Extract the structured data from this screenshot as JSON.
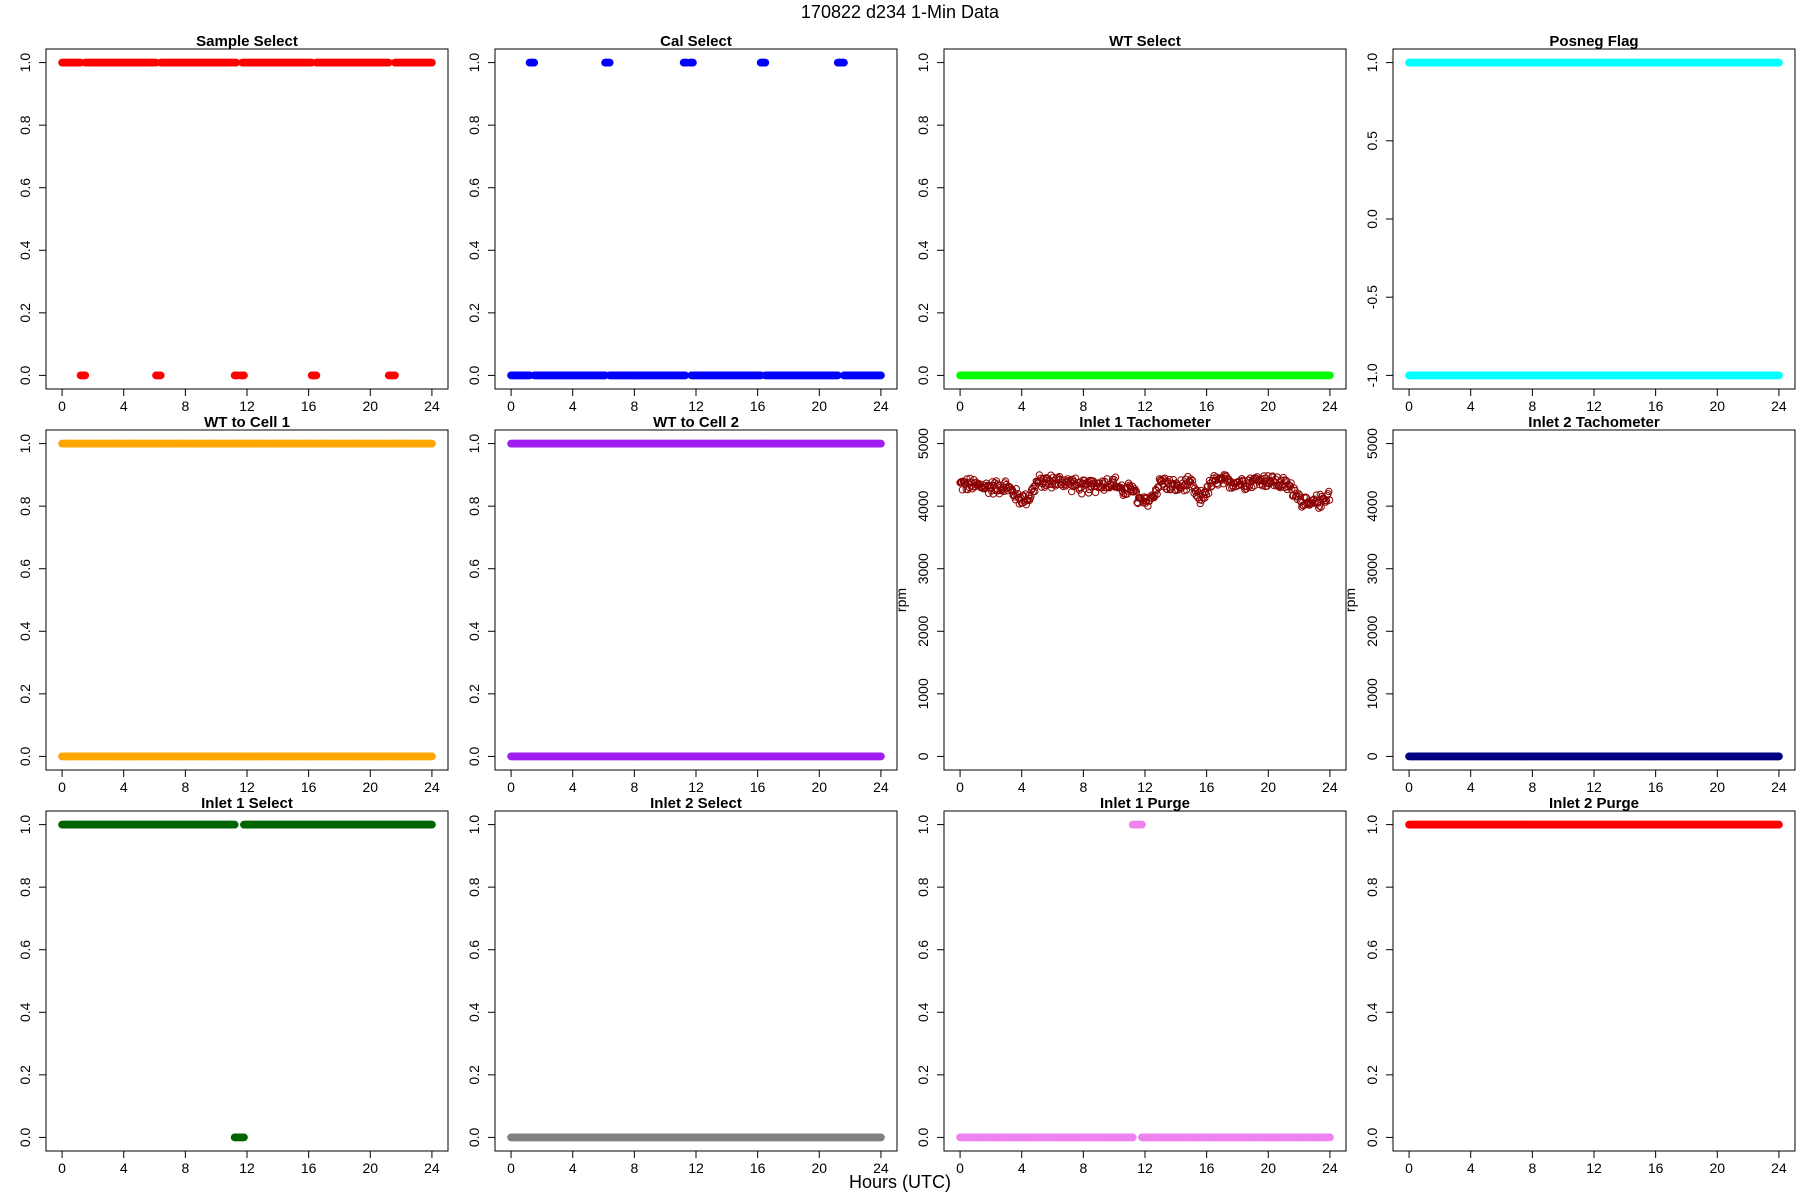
{
  "page_title": "170822   d234   1-Min Data",
  "x_axis_title": "Hours (UTC)",
  "chart_data": [
    {
      "type": "scatter",
      "title": "Sample Select",
      "color": "#ff0000",
      "marker": "filled",
      "xlim": [
        0,
        24
      ],
      "ylim": [
        0,
        1
      ],
      "xticks": [
        0,
        4,
        8,
        12,
        16,
        20,
        24
      ],
      "yticks": [
        0,
        0.2,
        0.4,
        0.6,
        0.8,
        1.0
      ],
      "ylabel": "",
      "segments": [
        {
          "y": 1,
          "x": [
            0,
            1.2
          ]
        },
        {
          "y": 1,
          "x": [
            1.5,
            6.1
          ]
        },
        {
          "y": 1,
          "x": [
            6.4,
            11.3
          ]
        },
        {
          "y": 1,
          "x": [
            11.7,
            16.2
          ]
        },
        {
          "y": 1,
          "x": [
            16.5,
            21.2
          ]
        },
        {
          "y": 1,
          "x": [
            21.6,
            24
          ]
        },
        {
          "y": 0,
          "x": [
            1.2,
            1.5
          ]
        },
        {
          "y": 0,
          "x": [
            6.1,
            6.4
          ]
        },
        {
          "y": 0,
          "x": [
            11.2,
            11.4
          ]
        },
        {
          "y": 0,
          "x": [
            11.6,
            11.8
          ]
        },
        {
          "y": 0,
          "x": [
            16.2,
            16.5
          ]
        },
        {
          "y": 0,
          "x": [
            21.2,
            21.6
          ]
        }
      ]
    },
    {
      "type": "scatter",
      "title": "Cal Select",
      "color": "#0000ff",
      "marker": "filled",
      "xlim": [
        0,
        24
      ],
      "ylim": [
        0,
        1
      ],
      "xticks": [
        0,
        4,
        8,
        12,
        16,
        20,
        24
      ],
      "yticks": [
        0,
        0.2,
        0.4,
        0.6,
        0.8,
        1.0
      ],
      "ylabel": "",
      "segments": [
        {
          "y": 0,
          "x": [
            0,
            1.2
          ]
        },
        {
          "y": 0,
          "x": [
            1.5,
            6.1
          ]
        },
        {
          "y": 0,
          "x": [
            6.4,
            11.3
          ]
        },
        {
          "y": 0,
          "x": [
            11.7,
            16.2
          ]
        },
        {
          "y": 0,
          "x": [
            16.5,
            21.2
          ]
        },
        {
          "y": 0,
          "x": [
            21.6,
            24
          ]
        },
        {
          "y": 1,
          "x": [
            1.2,
            1.5
          ]
        },
        {
          "y": 1,
          "x": [
            6.1,
            6.4
          ]
        },
        {
          "y": 1,
          "x": [
            11.2,
            11.4
          ]
        },
        {
          "y": 1,
          "x": [
            11.6,
            11.8
          ]
        },
        {
          "y": 1,
          "x": [
            16.2,
            16.5
          ]
        },
        {
          "y": 1,
          "x": [
            21.2,
            21.6
          ]
        }
      ]
    },
    {
      "type": "scatter",
      "title": "WT Select",
      "color": "#00ff00",
      "marker": "filled",
      "xlim": [
        0,
        24
      ],
      "ylim": [
        0,
        1
      ],
      "xticks": [
        0,
        4,
        8,
        12,
        16,
        20,
        24
      ],
      "yticks": [
        0,
        0.2,
        0.4,
        0.6,
        0.8,
        1.0
      ],
      "ylabel": "",
      "segments": [
        {
          "y": 0,
          "x": [
            0,
            24
          ]
        }
      ]
    },
    {
      "type": "scatter",
      "title": "Posneg Flag",
      "color": "#00ffff",
      "marker": "filled",
      "xlim": [
        0,
        24
      ],
      "ylim": [
        -1,
        1
      ],
      "xticks": [
        0,
        4,
        8,
        12,
        16,
        20,
        24
      ],
      "yticks": [
        -1.0,
        -0.5,
        0.0,
        0.5,
        1.0
      ],
      "ylabel": "",
      "segments": [
        {
          "y": 1,
          "x": [
            0,
            24
          ]
        },
        {
          "y": -1,
          "x": [
            0,
            24
          ]
        }
      ]
    },
    {
      "type": "scatter",
      "title": "WT to Cell 1",
      "color": "#ffa500",
      "marker": "filled",
      "xlim": [
        0,
        24
      ],
      "ylim": [
        0,
        1
      ],
      "xticks": [
        0,
        4,
        8,
        12,
        16,
        20,
        24
      ],
      "yticks": [
        0,
        0.2,
        0.4,
        0.6,
        0.8,
        1.0
      ],
      "ylabel": "",
      "segments": [
        {
          "y": 1,
          "x": [
            0,
            24
          ]
        },
        {
          "y": 0,
          "x": [
            0,
            24
          ]
        }
      ]
    },
    {
      "type": "scatter",
      "title": "WT to Cell 2",
      "color": "#a020f0",
      "marker": "filled",
      "xlim": [
        0,
        24
      ],
      "ylim": [
        0,
        1
      ],
      "xticks": [
        0,
        4,
        8,
        12,
        16,
        20,
        24
      ],
      "yticks": [
        0,
        0.2,
        0.4,
        0.6,
        0.8,
        1.0
      ],
      "ylabel": "",
      "segments": [
        {
          "y": 1,
          "x": [
            0,
            24
          ]
        },
        {
          "y": 0,
          "x": [
            0,
            24
          ]
        }
      ]
    },
    {
      "type": "scatter",
      "title": "Inlet 1 Tachometer",
      "color": "#8b0000",
      "marker": "open",
      "xlim": [
        0,
        24
      ],
      "ylim": [
        0,
        5000
      ],
      "xticks": [
        0,
        4,
        8,
        12,
        16,
        20,
        24
      ],
      "yticks": [
        0,
        1000,
        2000,
        3000,
        4000,
        5000
      ],
      "ylabel": "rpm",
      "noisy_series": {
        "x_start": 0,
        "x_end": 24,
        "step": 0.0333,
        "profile": [
          [
            0,
            4350
          ],
          [
            1,
            4330
          ],
          [
            2,
            4300
          ],
          [
            3,
            4320
          ],
          [
            3.5,
            4200
          ],
          [
            4,
            4100
          ],
          [
            4.5,
            4150
          ],
          [
            5,
            4380
          ],
          [
            6,
            4400
          ],
          [
            7,
            4380
          ],
          [
            8,
            4300
          ],
          [
            9,
            4350
          ],
          [
            10,
            4380
          ],
          [
            10.8,
            4200
          ],
          [
            11.2,
            4350
          ],
          [
            11.5,
            4100
          ],
          [
            12,
            4050
          ],
          [
            12.5,
            4150
          ],
          [
            13,
            4400
          ],
          [
            14,
            4300
          ],
          [
            15,
            4350
          ],
          [
            15.5,
            4100
          ],
          [
            16,
            4250
          ],
          [
            16.5,
            4400
          ],
          [
            18,
            4380
          ],
          [
            19,
            4400
          ],
          [
            20,
            4420
          ],
          [
            21,
            4350
          ],
          [
            21.5,
            4300
          ],
          [
            22,
            4150
          ],
          [
            22.5,
            4000
          ],
          [
            23,
            4050
          ],
          [
            23.5,
            4100
          ],
          [
            24,
            4200
          ]
        ],
        "noise": 140
      }
    },
    {
      "type": "scatter",
      "title": "Inlet 2 Tachometer",
      "color": "#000080",
      "marker": "filled",
      "xlim": [
        0,
        24
      ],
      "ylim": [
        0,
        5000
      ],
      "xticks": [
        0,
        4,
        8,
        12,
        16,
        20,
        24
      ],
      "yticks": [
        0,
        1000,
        2000,
        3000,
        4000,
        5000
      ],
      "ylabel": "rpm",
      "segments": [
        {
          "y": 0,
          "x": [
            0,
            24
          ]
        }
      ]
    },
    {
      "type": "scatter",
      "title": "Inlet 1 Select",
      "color": "#006400",
      "marker": "filled",
      "xlim": [
        0,
        24
      ],
      "ylim": [
        0,
        1
      ],
      "xticks": [
        0,
        4,
        8,
        12,
        16,
        20,
        24
      ],
      "yticks": [
        0,
        0.2,
        0.4,
        0.6,
        0.8,
        1.0
      ],
      "ylabel": "",
      "segments": [
        {
          "y": 1,
          "x": [
            0,
            11.2
          ]
        },
        {
          "y": 1,
          "x": [
            11.8,
            24
          ]
        },
        {
          "y": 0,
          "x": [
            11.2,
            11.8
          ]
        }
      ]
    },
    {
      "type": "scatter",
      "title": "Inlet 2 Select",
      "color": "#808080",
      "marker": "filled",
      "xlim": [
        0,
        24
      ],
      "ylim": [
        0,
        1
      ],
      "xticks": [
        0,
        4,
        8,
        12,
        16,
        20,
        24
      ],
      "yticks": [
        0,
        0.2,
        0.4,
        0.6,
        0.8,
        1.0
      ],
      "ylabel": "",
      "segments": [
        {
          "y": 0,
          "x": [
            0,
            24
          ]
        }
      ]
    },
    {
      "type": "scatter",
      "title": "Inlet 1 Purge",
      "color": "#ee82ee",
      "marker": "filled",
      "xlim": [
        0,
        24
      ],
      "ylim": [
        0,
        1
      ],
      "xticks": [
        0,
        4,
        8,
        12,
        16,
        20,
        24
      ],
      "yticks": [
        0,
        0.2,
        0.4,
        0.6,
        0.8,
        1.0
      ],
      "ylabel": "",
      "segments": [
        {
          "y": 0,
          "x": [
            0,
            11.2
          ]
        },
        {
          "y": 0,
          "x": [
            11.8,
            24
          ]
        },
        {
          "y": 1,
          "x": [
            11.2,
            11.8
          ]
        }
      ]
    },
    {
      "type": "scatter",
      "title": "Inlet 2 Purge",
      "color": "#ff0000",
      "marker": "filled",
      "xlim": [
        0,
        24
      ],
      "ylim": [
        0,
        1
      ],
      "xticks": [
        0,
        4,
        8,
        12,
        16,
        20,
        24
      ],
      "yticks": [
        0,
        0.2,
        0.4,
        0.6,
        0.8,
        1.0
      ],
      "ylabel": "",
      "segments": [
        {
          "y": 1,
          "x": [
            0,
            24
          ]
        }
      ]
    }
  ]
}
